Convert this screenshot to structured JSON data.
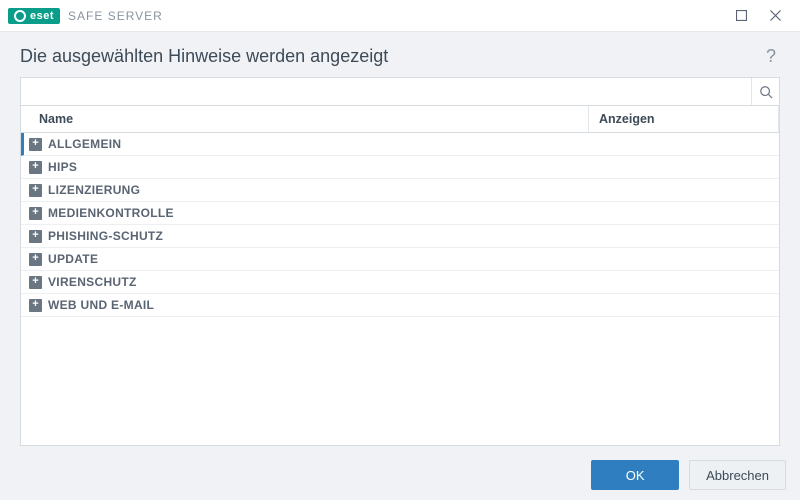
{
  "brand": {
    "badge": "eset",
    "product": "SAFE SERVER"
  },
  "page": {
    "title": "Die ausgewählten Hinweise werden angezeigt"
  },
  "search": {
    "placeholder": ""
  },
  "table": {
    "headers": {
      "name": "Name",
      "show": "Anzeigen"
    },
    "rows": [
      {
        "label": "ALLGEMEIN",
        "selected": true
      },
      {
        "label": "HIPS",
        "selected": false
      },
      {
        "label": "LIZENZIERUNG",
        "selected": false
      },
      {
        "label": "MEDIENKONTROLLE",
        "selected": false
      },
      {
        "label": "PHISHING-SCHUTZ",
        "selected": false
      },
      {
        "label": "UPDATE",
        "selected": false
      },
      {
        "label": "VIRENSCHUTZ",
        "selected": false
      },
      {
        "label": "WEB UND E-MAIL",
        "selected": false
      }
    ]
  },
  "buttons": {
    "ok": "OK",
    "cancel": "Abbrechen"
  },
  "icons": {
    "help": "?"
  }
}
